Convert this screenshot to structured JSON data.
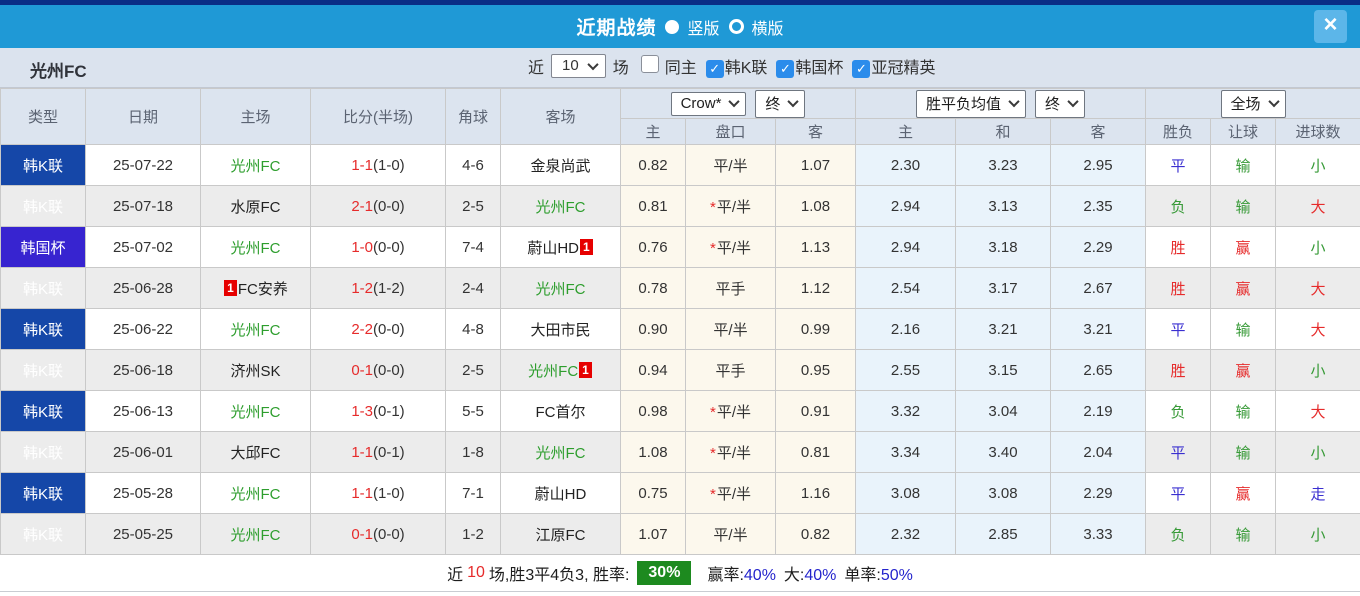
{
  "colors": {
    "titlebar": "#1f99d6",
    "top_strip": "#0a2d85",
    "league_blue": "#1547a8",
    "cup_blue": "#3724d0",
    "team_green": "#2e9e2e",
    "score_red": "#e62b2b",
    "win_rate_green": "#1d8a1f",
    "checkbox_blue": "#2b8ceb"
  },
  "titlebar": {
    "title": "近期战绩",
    "radio_vertical": "竖版",
    "radio_horizontal": "横版",
    "close": "×"
  },
  "filter": {
    "team": "光州FC",
    "near_label": "近",
    "count": "10",
    "games_label": "场",
    "checkboxes": [
      {
        "label": "同主",
        "checked": false
      },
      {
        "label": "韩K联",
        "checked": true
      },
      {
        "label": "韩国杯",
        "checked": true
      },
      {
        "label": "亚冠精英",
        "checked": true
      }
    ]
  },
  "table": {
    "headers": {
      "type": "类型",
      "date": "日期",
      "home": "主场",
      "score": "比分(半场)",
      "corners": "角球",
      "away": "客场",
      "ah_company_select": "Crow*",
      "ah_status_select": "终",
      "odds_company_select": "胜平负均值",
      "odds_status_select": "终",
      "scope_select": "全场",
      "sub": [
        "主",
        "盘口",
        "客",
        "主",
        "和",
        "客",
        "胜负",
        "让球",
        "进球数"
      ]
    },
    "rows": [
      {
        "league": "韩K联",
        "cup": false,
        "date": "25-07-22",
        "home": "光州FC",
        "home_green": true,
        "home_badge_pre": "",
        "away": "金泉尚武",
        "away_green": false,
        "away_badge_post": "",
        "score": "1-1",
        "half": "(1-0)",
        "corners": "4-6",
        "ah_home": "0.82",
        "ah_star": false,
        "ah_line": "平/半",
        "ah_away": "1.07",
        "avg_home": "2.30",
        "avg_draw": "3.23",
        "avg_away": "2.95",
        "result": "平",
        "result_color": "blue",
        "handicap": "输",
        "handicap_color": "green",
        "goals": "小",
        "goals_color": "green"
      },
      {
        "league": "韩K联",
        "cup": false,
        "date": "25-07-18",
        "home": "水原FC",
        "home_green": false,
        "home_badge_pre": "",
        "away": "光州FC",
        "away_green": true,
        "away_badge_post": "",
        "score": "2-1",
        "half": "(0-0)",
        "corners": "2-5",
        "ah_home": "0.81",
        "ah_star": true,
        "ah_line": "平/半",
        "ah_away": "1.08",
        "avg_home": "2.94",
        "avg_draw": "3.13",
        "avg_away": "2.35",
        "result": "负",
        "result_color": "green",
        "handicap": "输",
        "handicap_color": "green",
        "goals": "大",
        "goals_color": "red"
      },
      {
        "league": "韩国杯",
        "cup": true,
        "date": "25-07-02",
        "home": "光州FC",
        "home_green": true,
        "home_badge_pre": "",
        "away": "蔚山HD",
        "away_green": false,
        "away_badge_post": "1",
        "score": "1-0",
        "half": "(0-0)",
        "corners": "7-4",
        "ah_home": "0.76",
        "ah_star": true,
        "ah_line": "平/半",
        "ah_away": "1.13",
        "avg_home": "2.94",
        "avg_draw": "3.18",
        "avg_away": "2.29",
        "result": "胜",
        "result_color": "red",
        "handicap": "赢",
        "handicap_color": "red",
        "goals": "小",
        "goals_color": "green"
      },
      {
        "league": "韩K联",
        "cup": false,
        "date": "25-06-28",
        "home": "FC安养",
        "home_green": false,
        "home_badge_pre": "1",
        "away": "光州FC",
        "away_green": true,
        "away_badge_post": "",
        "score": "1-2",
        "half": "(1-2)",
        "corners": "2-4",
        "ah_home": "0.78",
        "ah_star": false,
        "ah_line": "平手",
        "ah_away": "1.12",
        "avg_home": "2.54",
        "avg_draw": "3.17",
        "avg_away": "2.67",
        "result": "胜",
        "result_color": "red",
        "handicap": "赢",
        "handicap_color": "red",
        "goals": "大",
        "goals_color": "red"
      },
      {
        "league": "韩K联",
        "cup": false,
        "date": "25-06-22",
        "home": "光州FC",
        "home_green": true,
        "home_badge_pre": "",
        "away": "大田市民",
        "away_green": false,
        "away_badge_post": "",
        "score": "2-2",
        "half": "(0-0)",
        "corners": "4-8",
        "ah_home": "0.90",
        "ah_star": false,
        "ah_line": "平/半",
        "ah_away": "0.99",
        "avg_home": "2.16",
        "avg_draw": "3.21",
        "avg_away": "3.21",
        "result": "平",
        "result_color": "blue",
        "handicap": "输",
        "handicap_color": "green",
        "goals": "大",
        "goals_color": "red"
      },
      {
        "league": "韩K联",
        "cup": false,
        "date": "25-06-18",
        "home": "济州SK",
        "home_green": false,
        "home_badge_pre": "",
        "away": "光州FC",
        "away_green": true,
        "away_badge_post": "1",
        "score": "0-1",
        "half": "(0-0)",
        "corners": "2-5",
        "ah_home": "0.94",
        "ah_star": false,
        "ah_line": "平手",
        "ah_away": "0.95",
        "avg_home": "2.55",
        "avg_draw": "3.15",
        "avg_away": "2.65",
        "result": "胜",
        "result_color": "red",
        "handicap": "赢",
        "handicap_color": "red",
        "goals": "小",
        "goals_color": "green"
      },
      {
        "league": "韩K联",
        "cup": false,
        "date": "25-06-13",
        "home": "光州FC",
        "home_green": true,
        "home_badge_pre": "",
        "away": "FC首尔",
        "away_green": false,
        "away_badge_post": "",
        "score": "1-3",
        "half": "(0-1)",
        "corners": "5-5",
        "ah_home": "0.98",
        "ah_star": true,
        "ah_line": "平/半",
        "ah_away": "0.91",
        "avg_home": "3.32",
        "avg_draw": "3.04",
        "avg_away": "2.19",
        "result": "负",
        "result_color": "green",
        "handicap": "输",
        "handicap_color": "green",
        "goals": "大",
        "goals_color": "red"
      },
      {
        "league": "韩K联",
        "cup": false,
        "date": "25-06-01",
        "home": "大邱FC",
        "home_green": false,
        "home_badge_pre": "",
        "away": "光州FC",
        "away_green": true,
        "away_badge_post": "",
        "score": "1-1",
        "half": "(0-1)",
        "corners": "1-8",
        "ah_home": "1.08",
        "ah_star": true,
        "ah_line": "平/半",
        "ah_away": "0.81",
        "avg_home": "3.34",
        "avg_draw": "3.40",
        "avg_away": "2.04",
        "result": "平",
        "result_color": "blue",
        "handicap": "输",
        "handicap_color": "green",
        "goals": "小",
        "goals_color": "green"
      },
      {
        "league": "韩K联",
        "cup": false,
        "date": "25-05-28",
        "home": "光州FC",
        "home_green": true,
        "home_badge_pre": "",
        "away": "蔚山HD",
        "away_green": false,
        "away_badge_post": "",
        "score": "1-1",
        "half": "(1-0)",
        "corners": "7-1",
        "ah_home": "0.75",
        "ah_star": true,
        "ah_line": "平/半",
        "ah_away": "1.16",
        "avg_home": "3.08",
        "avg_draw": "3.08",
        "avg_away": "2.29",
        "result": "平",
        "result_color": "blue",
        "handicap": "赢",
        "handicap_color": "red",
        "goals": "走",
        "goals_color": "blue"
      },
      {
        "league": "韩K联",
        "cup": false,
        "date": "25-05-25",
        "home": "光州FC",
        "home_green": true,
        "home_badge_pre": "",
        "away": "江原FC",
        "away_green": false,
        "away_badge_post": "",
        "score": "0-1",
        "half": "(0-0)",
        "corners": "1-2",
        "ah_home": "1.07",
        "ah_star": false,
        "ah_line": "平/半",
        "ah_away": "0.82",
        "avg_home": "2.32",
        "avg_draw": "2.85",
        "avg_away": "3.33",
        "result": "负",
        "result_color": "green",
        "handicap": "输",
        "handicap_color": "green",
        "goals": "小",
        "goals_color": "green"
      }
    ]
  },
  "summary": {
    "near_label": "近",
    "count": "10",
    "record": "场,胜3平4负3, 胜率:",
    "win_rate": "30%",
    "segments": [
      {
        "label": "赢率:",
        "value": "40%"
      },
      {
        "label": "大:",
        "value": "40%"
      },
      {
        "label": "单率:",
        "value": "50%"
      }
    ]
  }
}
